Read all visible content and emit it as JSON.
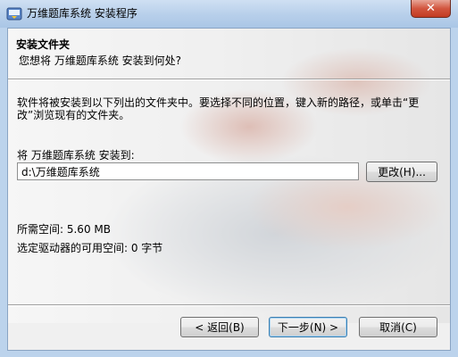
{
  "window": {
    "title": "万维题库系统 安装程序",
    "close_label": "✕"
  },
  "header": {
    "title": "安装文件夹",
    "subtitle": "您想将 万维题库系统 安装到何处?"
  },
  "main": {
    "instruction": "软件将被安装到以下列出的文件夹中。要选择不同的位置，键入新的路径，或单击“更改”浏览现有的文件夹。",
    "install_label": "将 万维题库系统 安装到:",
    "install_path": "d:\\万维题库系统",
    "browse_label": "更改(H)...",
    "space_required": "所需空间: 5.60 MB",
    "space_available": "选定驱动器的可用空间: 0 字节"
  },
  "footer": {
    "back_label": "< 返回(B)",
    "next_label": "下一步(N) >",
    "cancel_label": "取消(C)"
  },
  "colors": {
    "titlebar": "#b7cfea",
    "close_button": "#c23b22",
    "dialog_bg": "#f0f0f0",
    "default_button_border": "#3c7fb1"
  },
  "icons": {
    "app": "installer-icon",
    "close": "close-icon"
  }
}
